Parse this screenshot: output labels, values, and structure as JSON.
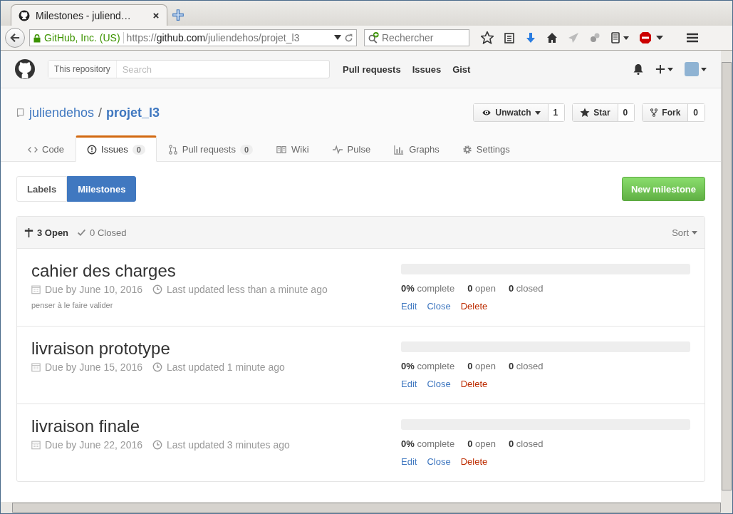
{
  "browser": {
    "tab_title": "Milestones - juliend…",
    "identity": "GitHub, Inc. (US)",
    "url_scheme": "https://",
    "url_host": "github.com",
    "url_path": "/juliendehos/projet_l3",
    "search_placeholder": "Rechercher"
  },
  "header": {
    "scope": "This repository",
    "search_placeholder": "Search",
    "nav": [
      "Pull requests",
      "Issues",
      "Gist"
    ]
  },
  "repo": {
    "owner": "juliendehos",
    "separator": "/",
    "name": "projet_l3",
    "actions": [
      {
        "kind": "watch",
        "label": "Unwatch",
        "count": "1"
      },
      {
        "kind": "star",
        "label": "Star",
        "count": "0"
      },
      {
        "kind": "fork",
        "label": "Fork",
        "count": "0"
      }
    ]
  },
  "tabs": [
    {
      "kind": "code",
      "label": "Code",
      "selected": false
    },
    {
      "kind": "issues",
      "label": "Issues",
      "count": "0",
      "selected": true
    },
    {
      "kind": "pulls",
      "label": "Pull requests",
      "count": "0",
      "selected": false
    },
    {
      "kind": "wiki",
      "label": "Wiki",
      "selected": false
    },
    {
      "kind": "pulse",
      "label": "Pulse",
      "selected": false
    },
    {
      "kind": "graphs",
      "label": "Graphs",
      "selected": false
    },
    {
      "kind": "settings",
      "label": "Settings",
      "selected": false
    }
  ],
  "subnav": [
    {
      "label": "Labels",
      "selected": false
    },
    {
      "label": "Milestones",
      "selected": true
    }
  ],
  "new_milestone": "New milestone",
  "filters": [
    {
      "kind": "open",
      "label": "3 Open",
      "selected": true
    },
    {
      "kind": "closed",
      "label": "0 Closed",
      "selected": false
    }
  ],
  "sort": "Sort",
  "milestones": [
    {
      "title": "cahier des charges",
      "due": "Due by June 10, 2016",
      "updated": "Last updated less than a minute ago",
      "description": "penser à le faire valider",
      "level": 0,
      "percent": "0%",
      "complete_label": "complete",
      "open_count": "0",
      "open_label": "open",
      "closed_count": "0",
      "closed_label": "closed",
      "actions": [
        {
          "kind": "edit",
          "label": "Edit"
        },
        {
          "kind": "close",
          "label": "Close"
        },
        {
          "kind": "delete",
          "label": "Delete"
        }
      ]
    },
    {
      "title": "livraison prototype",
      "due": "Due by June 15, 2016",
      "updated": "Last updated 1 minute ago",
      "level": 0,
      "percent": "0%",
      "complete_label": "complete",
      "open_count": "0",
      "open_label": "open",
      "closed_count": "0",
      "closed_label": "closed",
      "actions": [
        {
          "kind": "edit",
          "label": "Edit"
        },
        {
          "kind": "close",
          "label": "Close"
        },
        {
          "kind": "delete",
          "label": "Delete"
        }
      ]
    },
    {
      "title": "livraison finale",
      "due": "Due by June 22, 2016",
      "updated": "Last updated 3 minutes ago",
      "level": 0,
      "percent": "0%",
      "complete_label": "complete",
      "open_count": "0",
      "open_label": "open",
      "closed_count": "0",
      "closed_label": "closed",
      "actions": [
        {
          "kind": "edit",
          "label": "Edit"
        },
        {
          "kind": "close",
          "label": "Close"
        },
        {
          "kind": "delete",
          "label": "Delete"
        }
      ]
    }
  ]
}
